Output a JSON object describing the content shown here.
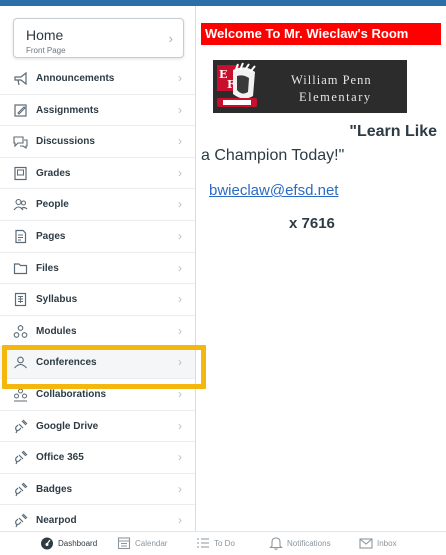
{
  "home": {
    "title": "Home",
    "subtitle": "Front Page",
    "chevron": "›"
  },
  "nav": {
    "chevron": "›",
    "items": [
      {
        "label": "Announcements",
        "icon": "megaphone-icon"
      },
      {
        "label": "Assignments",
        "icon": "assignment-icon"
      },
      {
        "label": "Discussions",
        "icon": "discussion-icon"
      },
      {
        "label": "Grades",
        "icon": "grades-icon"
      },
      {
        "label": "People",
        "icon": "people-icon"
      },
      {
        "label": "Pages",
        "icon": "page-icon"
      },
      {
        "label": "Files",
        "icon": "folder-icon"
      },
      {
        "label": "Syllabus",
        "icon": "syllabus-icon"
      },
      {
        "label": "Modules",
        "icon": "modules-icon"
      },
      {
        "label": "Conferences",
        "icon": "conferences-icon",
        "active": true
      },
      {
        "label": "Collaborations",
        "icon": "collaborations-icon"
      },
      {
        "label": "Google Drive",
        "icon": "plug-icon"
      },
      {
        "label": "Office 365",
        "icon": "plug-icon"
      },
      {
        "label": "Badges",
        "icon": "plug-icon"
      },
      {
        "label": "Nearpod",
        "icon": "plug-icon"
      }
    ]
  },
  "main": {
    "welcome": "Welcome To Mr. Wieclaw's Room",
    "banner": {
      "line1": "William Penn",
      "line2": "Elementary",
      "logo_icon": "warriors-logo"
    },
    "quote_line1": "\"Learn Like",
    "quote_line2": "a Champion Today!\"",
    "email": "bwieclaw@efsd.net",
    "extension": "x 7616"
  },
  "tabbar": {
    "tabs": [
      {
        "label": "Dashboard",
        "icon": "dashboard-icon",
        "active": true
      },
      {
        "label": "Calendar",
        "icon": "calendar-icon"
      },
      {
        "label": "To Do",
        "icon": "todo-icon"
      },
      {
        "label": "Notifications",
        "icon": "bell-icon"
      },
      {
        "label": "Inbox",
        "icon": "inbox-icon"
      }
    ]
  },
  "colors": {
    "accent": "#f5b60d",
    "welcome_bg": "#ff0000",
    "link": "#2b6bc6",
    "top_bar": "#2b6ea8"
  }
}
